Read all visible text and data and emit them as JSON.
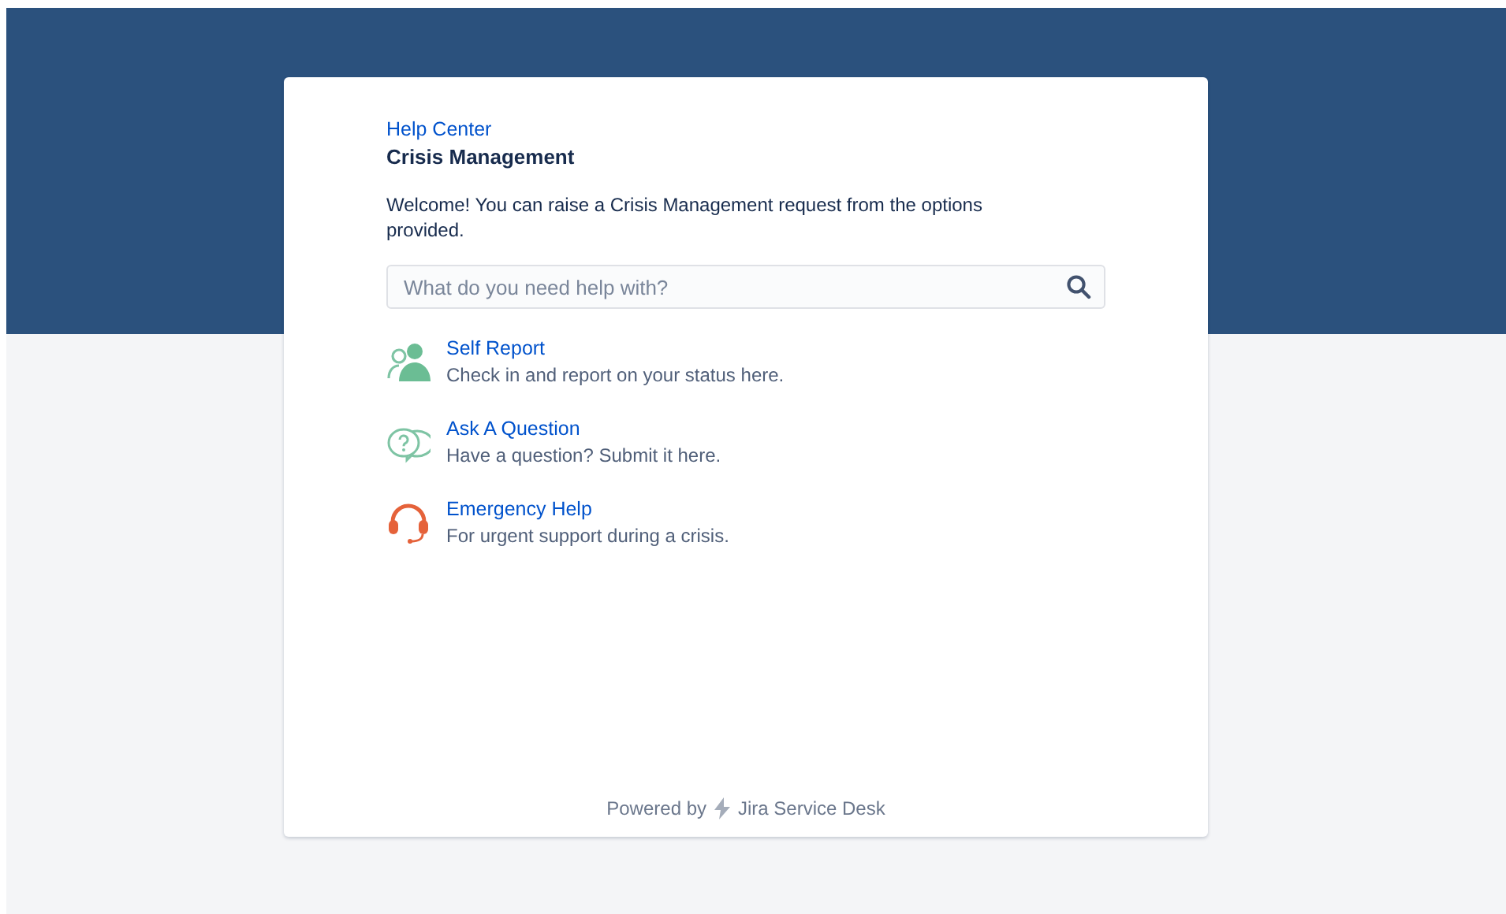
{
  "breadcrumb": "Help Center",
  "title": "Crisis Management",
  "welcome": "Welcome! You can raise a Crisis Management request from the options provided.",
  "search": {
    "placeholder": "What do you need help with?"
  },
  "request_types": [
    {
      "kind": "person",
      "name": "Self Report",
      "description": "Check in and report on your status here."
    },
    {
      "kind": "question",
      "name": "Ask A Question",
      "description": "Have a question? Submit it here."
    },
    {
      "kind": "headset",
      "name": "Emergency Help",
      "description": "For urgent support during a crisis."
    }
  ],
  "footer": {
    "prefix": "Powered by",
    "product": "Jira Service Desk"
  }
}
